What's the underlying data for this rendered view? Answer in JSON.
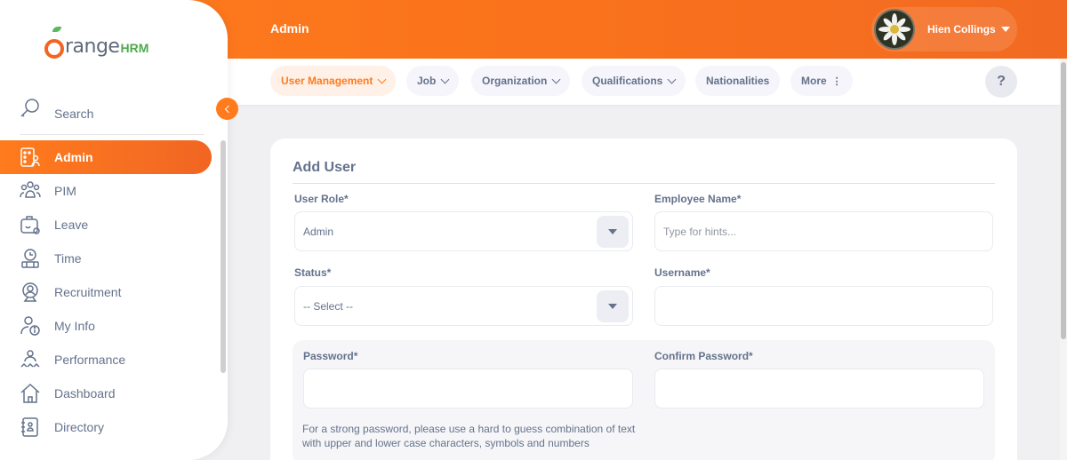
{
  "brand": {
    "logo_main": "range",
    "logo_suffix": "HRM",
    "accent": "#ff7b1d",
    "active_bg": "#fff1e8"
  },
  "header": {
    "title": "Admin",
    "user_name": "Hien Collings",
    "help_label": "?"
  },
  "nav_tabs": [
    {
      "label": "User Management",
      "active": true,
      "has_chevron": true
    },
    {
      "label": "Job",
      "has_chevron": true
    },
    {
      "label": "Organization",
      "has_chevron": true
    },
    {
      "label": "Qualifications",
      "has_chevron": true
    },
    {
      "label": "Nationalities",
      "has_chevron": false
    },
    {
      "label": "More",
      "has_dots": true
    }
  ],
  "sidebar": {
    "search_label": "Search",
    "items": [
      {
        "label": "Admin",
        "icon": "admin-icon",
        "active": true
      },
      {
        "label": "PIM",
        "icon": "pim-icon"
      },
      {
        "label": "Leave",
        "icon": "leave-icon"
      },
      {
        "label": "Time",
        "icon": "time-icon"
      },
      {
        "label": "Recruitment",
        "icon": "recruitment-icon"
      },
      {
        "label": "My Info",
        "icon": "my-info-icon"
      },
      {
        "label": "Performance",
        "icon": "performance-icon"
      },
      {
        "label": "Dashboard",
        "icon": "dashboard-icon"
      },
      {
        "label": "Directory",
        "icon": "directory-icon"
      }
    ]
  },
  "form": {
    "title": "Add User",
    "user_role": {
      "label": "User Role*",
      "value": "Admin"
    },
    "employee_name": {
      "label": "Employee Name*",
      "placeholder": "Type for hints..."
    },
    "status": {
      "label": "Status*",
      "value": "-- Select --"
    },
    "username": {
      "label": "Username*",
      "value": ""
    },
    "password": {
      "label": "Password*",
      "value": ""
    },
    "confirm_password": {
      "label": "Confirm Password*",
      "value": ""
    },
    "password_hint": "For a strong password, please use a hard to guess combination of text with upper and lower case characters, symbols and numbers"
  }
}
